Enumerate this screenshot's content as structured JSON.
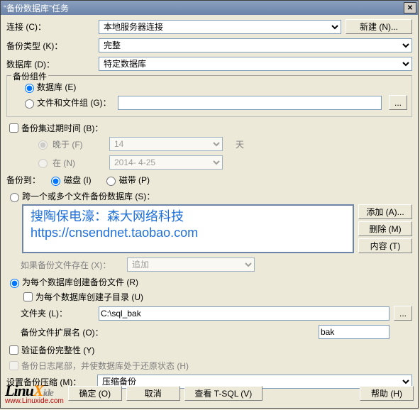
{
  "window": {
    "title": "“备份数据库”任务"
  },
  "fields": {
    "connection_label": "连接 (C)：",
    "connection_value": "本地服务器连接",
    "new_button": "新建 (N)...",
    "backup_type_label": "备份类型 (K)：",
    "backup_type_value": "完整",
    "database_label": "数据库 (D)：",
    "database_value": "特定数据库"
  },
  "components": {
    "group_title": "备份组件",
    "db_radio": "数据库 (E)",
    "files_radio": "文件和文件组 (G)：",
    "files_value": ""
  },
  "expire": {
    "checkbox": "备份集过期时间 (B)：",
    "after_radio": "晚于 (F)",
    "after_value": "14",
    "after_unit": "天",
    "on_radio": "在 (N)",
    "on_value": "2014- 4-25"
  },
  "dest": {
    "label": "备份到：",
    "disk_radio": "磁盘 (I)",
    "tape_radio": "磁带 (P)"
  },
  "across": {
    "radio": "跨一个或多个文件备份数据库 (S)：",
    "overlay_line1": "搜陶保电濠：森大网络科技",
    "overlay_line2": "https://cnsendnet.taobao.com",
    "add_btn": "添加 (A)...",
    "remove_btn": "删除 (M)",
    "content_btn": "内容 (T)",
    "if_exists_label": "如果备份文件存在 (X)：",
    "if_exists_value": "追加"
  },
  "per_db": {
    "radio": "为每个数据库创建备份文件 (R)",
    "subdir_chk": "为每个数据库创建子目录 (U)",
    "folder_label": "文件夹 (L)：",
    "folder_value": "C:\\sql_bak",
    "ext_label": "备份文件扩展名 (O)：",
    "ext_value": "bak"
  },
  "verify_chk": "验证备份完整性 (Y)",
  "tail_chk": "备份日志尾部，并使数据库处于还原状态 (H)",
  "compress": {
    "label": "设置备份压缩 (M)：",
    "value": "压缩备份"
  },
  "buttons": {
    "ok": "确定 (O)",
    "cancel": "取消",
    "view_tsql": "查看 T-SQL (V)",
    "help": "帮助 (H)"
  },
  "logo": {
    "text_l": "L",
    "text_inu": "inu",
    "text_x": "X",
    "url": "www.Linuxide.com",
    "text_ide": "ide"
  }
}
